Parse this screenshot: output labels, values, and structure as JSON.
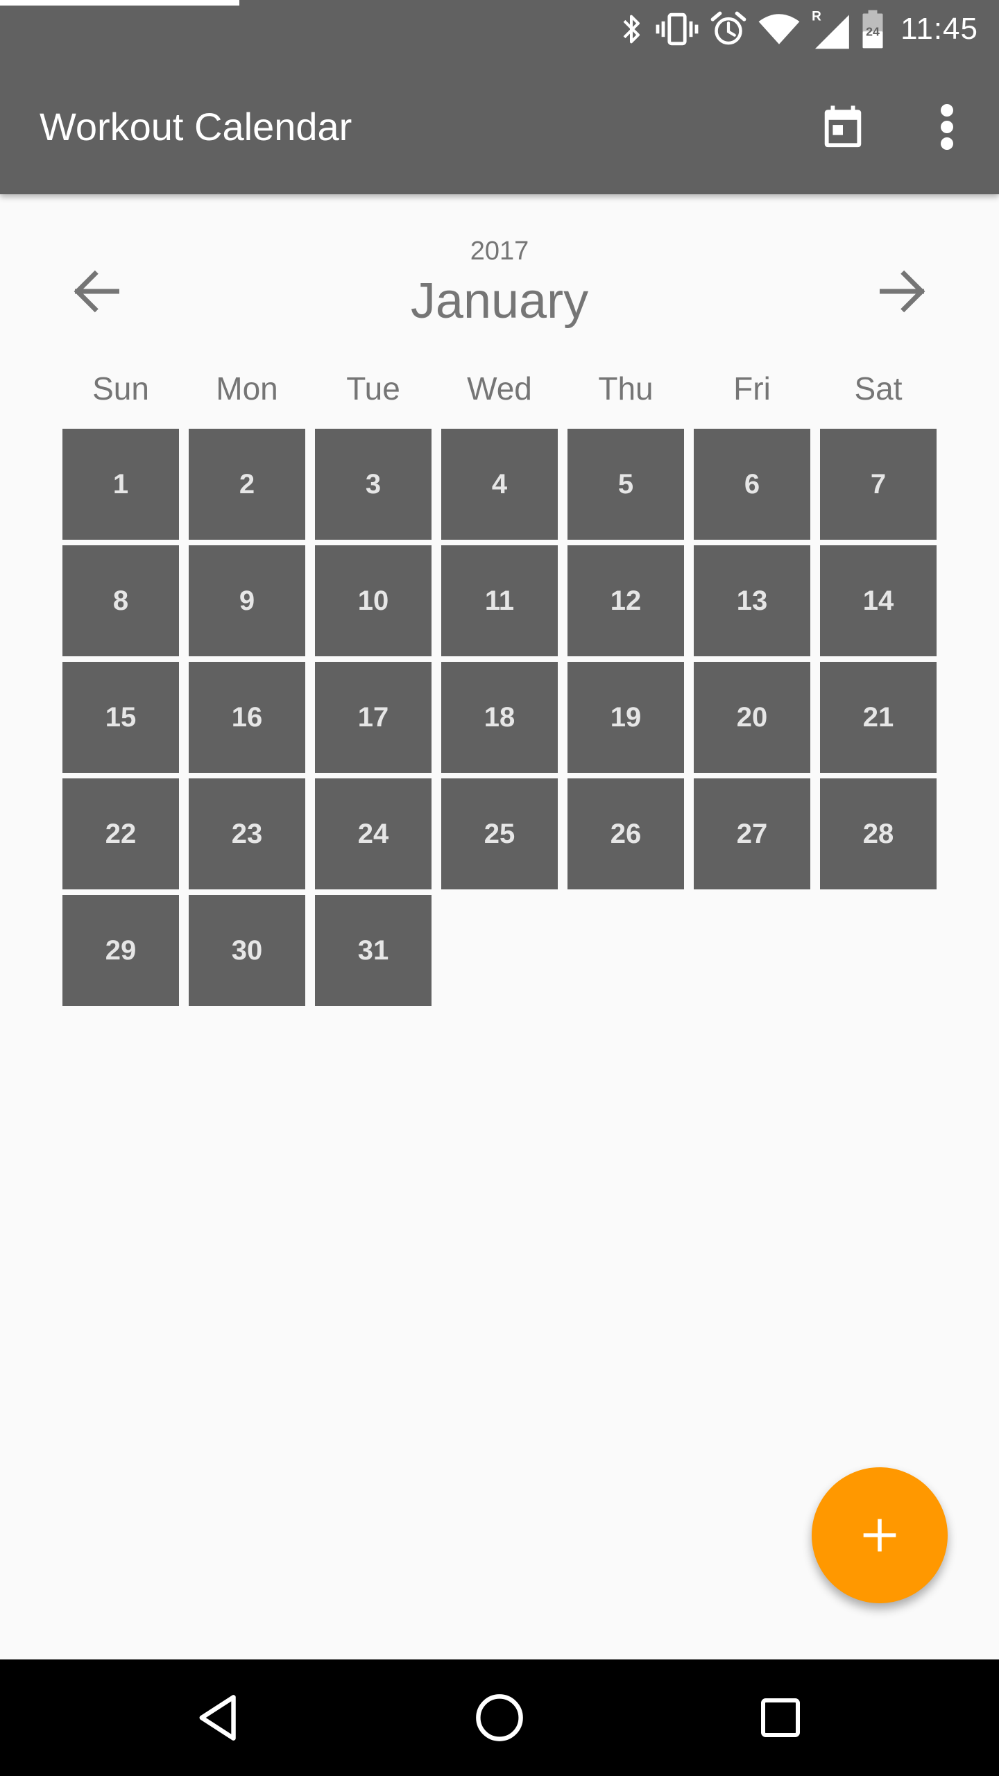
{
  "status_bar": {
    "time": "11:45",
    "battery_level": "24",
    "roaming_indicator": "R",
    "icons": [
      "bluetooth-icon",
      "vibrate-icon",
      "alarm-icon",
      "wifi-icon",
      "signal-icon",
      "battery-icon"
    ]
  },
  "app_bar": {
    "title": "Workout Calendar",
    "actions": [
      "calendar-today-icon",
      "more-vert-icon"
    ]
  },
  "calendar": {
    "year": "2017",
    "month": "January",
    "weekdays": [
      "Sun",
      "Mon",
      "Tue",
      "Wed",
      "Thu",
      "Fri",
      "Sat"
    ],
    "leading_blank_days": 0,
    "days": [
      "1",
      "2",
      "3",
      "4",
      "5",
      "6",
      "7",
      "8",
      "9",
      "10",
      "11",
      "12",
      "13",
      "14",
      "15",
      "16",
      "17",
      "18",
      "19",
      "20",
      "21",
      "22",
      "23",
      "24",
      "25",
      "26",
      "27",
      "28",
      "29",
      "30",
      "31"
    ]
  },
  "fab": {
    "icon": "add-icon",
    "color": "#FF9800"
  },
  "colors": {
    "app_bar": "#616161",
    "day_cell": "#616161",
    "day_text": "#E6E6E6",
    "secondary_text": "#757575",
    "background": "#FAFAFA",
    "accent": "#FF9800"
  },
  "nav_bar": {
    "buttons": [
      "back-icon",
      "home-icon",
      "recents-icon"
    ]
  }
}
